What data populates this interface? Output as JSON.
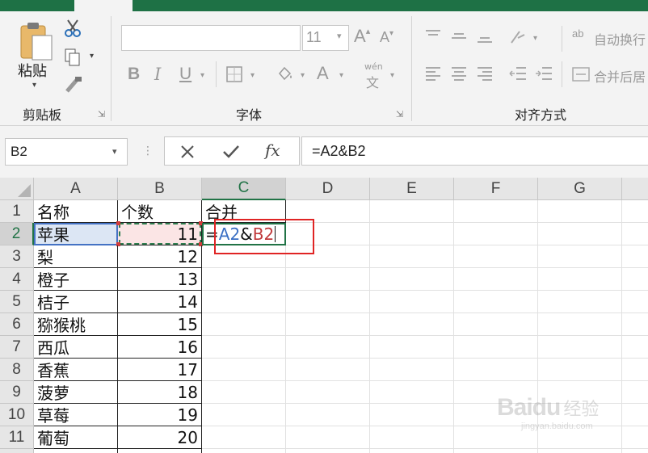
{
  "ribbon": {
    "clipboard": {
      "paste_label": "粘贴",
      "group_label": "剪贴板"
    },
    "font": {
      "font_size": "11",
      "bold": "B",
      "italic": "I",
      "underline": "U",
      "font_color": "A",
      "phonetic": "wén",
      "phonetic_char": "文",
      "group_label": "字体"
    },
    "alignment": {
      "wrap_text": "自动换行",
      "merge_center": "合并后居",
      "group_label": "对齐方式"
    }
  },
  "formula_bar": {
    "name_box": "B2",
    "fx_label": "fx",
    "formula": "=A2&B2"
  },
  "grid": {
    "columns": [
      "A",
      "B",
      "C",
      "D",
      "E",
      "F",
      "G"
    ],
    "rows": [
      "1",
      "2",
      "3",
      "4",
      "5",
      "6",
      "7",
      "8",
      "9",
      "10",
      "11"
    ],
    "headers": {
      "a": "名称",
      "b": "个数",
      "c": "合并"
    },
    "data": [
      {
        "name": "苹果",
        "count": "11"
      },
      {
        "name": "梨",
        "count": "12"
      },
      {
        "name": "橙子",
        "count": "13"
      },
      {
        "name": "桔子",
        "count": "14"
      },
      {
        "name": "猕猴桃",
        "count": "15"
      },
      {
        "name": "西瓜",
        "count": "16"
      },
      {
        "name": "香蕉",
        "count": "17"
      },
      {
        "name": "菠萝",
        "count": "18"
      },
      {
        "name": "草莓",
        "count": "19"
      },
      {
        "name": "葡萄",
        "count": "20"
      }
    ],
    "editing_formula": {
      "eq": "=",
      "ref1": "A2",
      "amp": "&",
      "ref2": "B2"
    }
  },
  "watermark": {
    "brand": "Baidu",
    "cn": "经验",
    "url": "jingyan.baidu.com"
  },
  "colors": {
    "excel_green": "#1e7145",
    "ref1_blue": "#3a6fc4",
    "ref2_red": "#c0393b",
    "annotation_red": "#e02424"
  }
}
